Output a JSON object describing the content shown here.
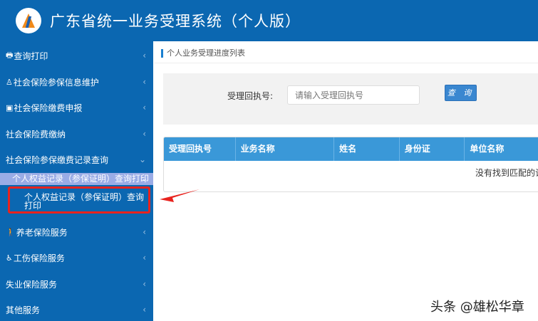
{
  "header": {
    "title": "广东省统一业务受理系统（个人版）"
  },
  "sidebar": {
    "items": [
      {
        "label": "查询打印",
        "icon": "print-icon"
      },
      {
        "label": "社会保险参保信息维护",
        "icon": "user-icon"
      },
      {
        "label": "社会保险缴费申报",
        "icon": "money-icon"
      },
      {
        "label": "社会保险费缴纳"
      },
      {
        "label": "社会保险参保缴费记录查询"
      }
    ],
    "sub_item": "个人权益记录（参保证明）查询打印",
    "leaf_item": "个人权益记录（参保证明）查询打印",
    "items2": [
      {
        "label": "养老保险服务",
        "icon": "elderly-icon"
      },
      {
        "label": "工伤保险服务",
        "icon": "wheelchair-icon"
      },
      {
        "label": "失业保险服务"
      },
      {
        "label": "其他服务"
      }
    ]
  },
  "main": {
    "title": "个人业务受理进度列表",
    "search": {
      "label": "受理回执号:",
      "placeholder": "请输入受理回执号",
      "button": "查 询"
    },
    "table": {
      "columns": [
        "受理回执号",
        "业务名称",
        "姓名",
        "身份证",
        "单位名称"
      ],
      "empty": "没有找到匹配的记"
    }
  },
  "watermark": "头条 @雄松华章",
  "colors": {
    "header": "#0b67b1",
    "highlight": "#e8231e",
    "table_header": "#3a98d8"
  }
}
